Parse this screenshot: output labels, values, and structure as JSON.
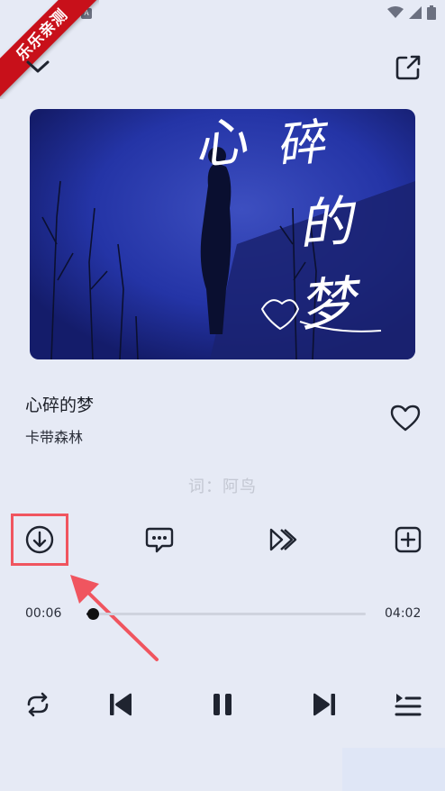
{
  "watermark": {
    "text": "乐乐亲测"
  },
  "song": {
    "title": "心碎的梦",
    "artist": "卡带森林",
    "liked": false
  },
  "lyric": {
    "current_line": "词：阿鸟"
  },
  "album_art": {
    "title_text": "心碎的梦"
  },
  "progress": {
    "elapsed": "00:06",
    "total": "04:02",
    "fraction": 0.025
  },
  "icons": {
    "collapse": "chevron-down-icon",
    "share": "share-icon",
    "like": "heart-icon",
    "download": "download-icon",
    "comment": "comment-icon",
    "speed": "fast-forward-icon",
    "add": "add-to-playlist-icon",
    "repeat": "repeat-icon",
    "prev": "previous-icon",
    "pause": "pause-icon",
    "next": "next-icon",
    "queue": "queue-icon"
  },
  "colors": {
    "background": "#e6eaf5",
    "highlight": "#f0555f",
    "ribbon": "#c8101a"
  }
}
